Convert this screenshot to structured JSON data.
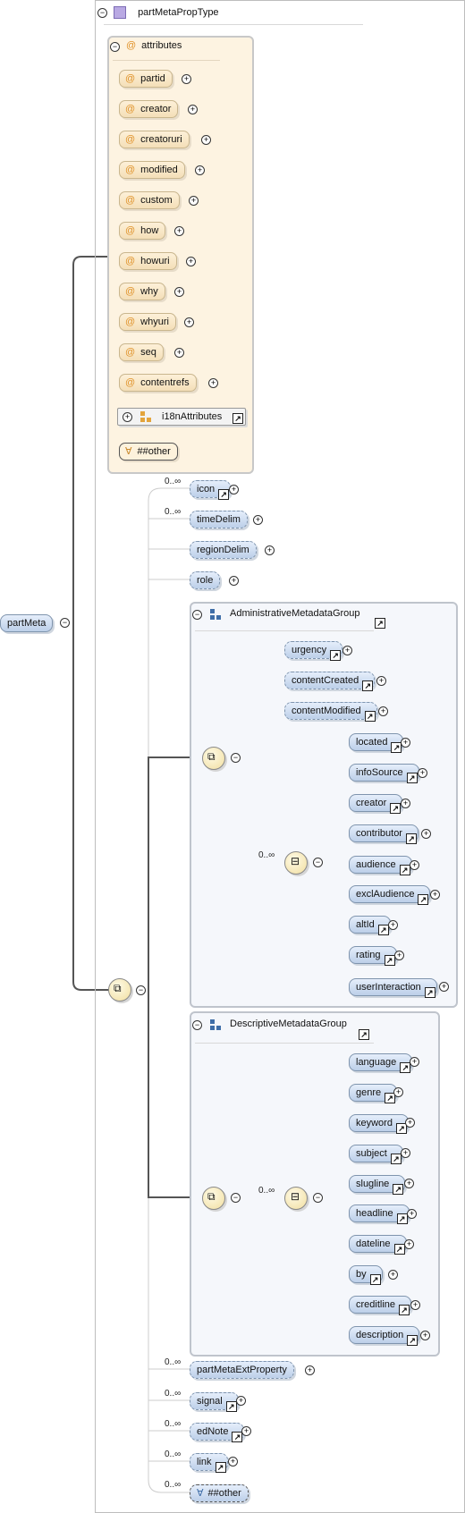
{
  "type_name": "partMetaPropType",
  "root": "partMeta",
  "attributes_title": "attributes",
  "attributes": [
    "partid",
    "creator",
    "creatoruri",
    "modified",
    "custom",
    "how",
    "howuri",
    "why",
    "whyuri",
    "seq",
    "contentrefs"
  ],
  "i18n": "i18nAttributes",
  "any_attribute": "##other",
  "cardinality_many": "0..∞",
  "seq_elements": [
    "icon",
    "timeDelim",
    "regionDelim",
    "role"
  ],
  "admin_group": {
    "title": "AdministrativeMetadataGroup",
    "elements": [
      "urgency",
      "contentCreated",
      "contentModified"
    ],
    "choice": [
      "located",
      "infoSource",
      "creator",
      "contributor",
      "audience",
      "exclAudience",
      "altId",
      "rating",
      "userInteraction"
    ]
  },
  "desc_group": {
    "title": "DescriptiveMetadataGroup",
    "choice": [
      "language",
      "genre",
      "keyword",
      "subject",
      "slugline",
      "headline",
      "dateline",
      "by",
      "creditline",
      "description"
    ]
  },
  "tail_elements": [
    "partMetaExtProperty",
    "signal",
    "edNote",
    "link"
  ],
  "any_element": "##other",
  "colors": {
    "element": "#c8d8ef",
    "attribute": "#f8e6c6",
    "frame": "#c7c7c7",
    "line": "#555555"
  }
}
